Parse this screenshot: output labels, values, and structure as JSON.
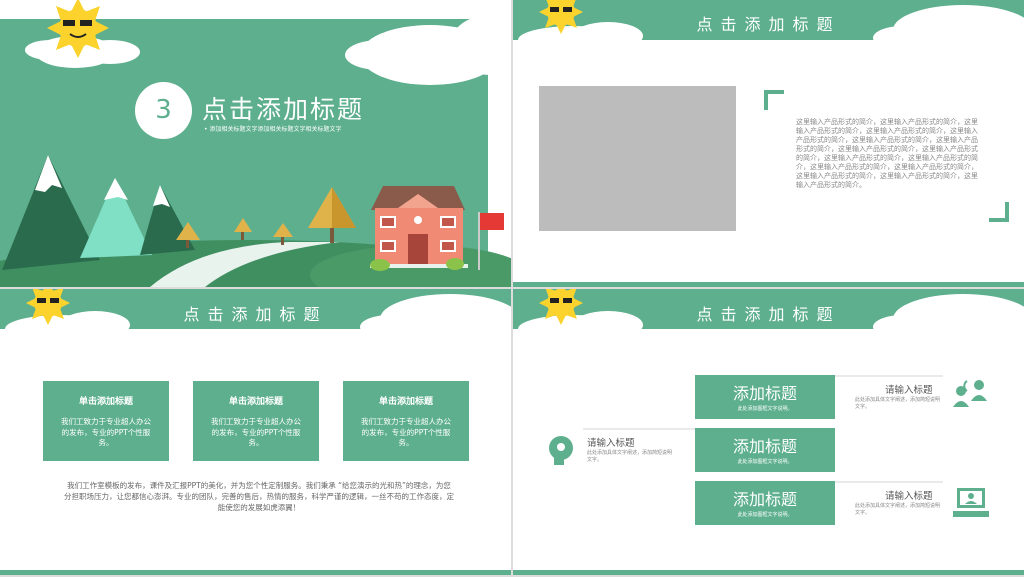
{
  "slide1": {
    "number": "3",
    "title": "点击添加标题",
    "subtitle": "• 添加相关标题文字添加相关标题文字相关标题文字"
  },
  "slide2": {
    "title": "点击添加标题",
    "body": "这里输入产品形式的简介，这里输入产品形式的简介，这里输入产品形式的简介，这里输入产品形式的简介，这里输入产品形式的简介，这里输入产品形式的简介，这里输入产品形式的简介，这里输入产品形式的简介，这里输入产品形式的简介，这里输入产品形式的简介，这里输入产品形式的简介，这里输入产品形式的简介，这里输入产品形式的简介，这里输入产品形式的简介，这里输入产品形式的简介，这里输入产品形式的简介。"
  },
  "slide3": {
    "title": "点击添加标题",
    "cards": [
      {
        "title": "单击添加标题",
        "body": "我们工致力于专业超人办公的发布，专业的PPT个性服务。"
      },
      {
        "title": "单击添加标题",
        "body": "我们工致力于专业超人办公的发布，专业的PPT个性服务。"
      },
      {
        "title": "单击添加标题",
        "body": "我们工致力于专业超人办公的发布，专业的PPT个性服务。"
      }
    ],
    "paragraph": "我们工作室模板的发布，课件及汇报PPT的美化，并为您个性定制服务。我们秉承 “给您演示的光和热”的理念，为您分担职场压力，让您都信心澎湃。专业的团队，完善的售后，热情的服务，科学严谨的逻辑，一丝不苟的工作态度，定能使您的发展如虎添翼！"
  },
  "slide4": {
    "title": "点击添加标题",
    "buttons": [
      {
        "title": "添加标题",
        "sub": "此处添加图框文字说明。"
      },
      {
        "title": "添加标题",
        "sub": "此处添加图框文字说明。"
      },
      {
        "title": "添加标题",
        "sub": "此处添加图框文字说明。"
      }
    ],
    "labels": [
      {
        "title": "请输入标题",
        "sub": "此处添加具体文字阐述，添加简短说明文字。"
      },
      {
        "title": "请输入标题",
        "sub": "此处添加具体文字阐述，添加简短说明文字。"
      },
      {
        "title": "请输入标题",
        "sub": "此处添加具体文字阐述，添加简短说明文字。"
      }
    ]
  },
  "colors": {
    "accent": "#5daf8e",
    "sun": "#fbd32c",
    "house": "#f08a75",
    "roof": "#8a5a4a"
  }
}
